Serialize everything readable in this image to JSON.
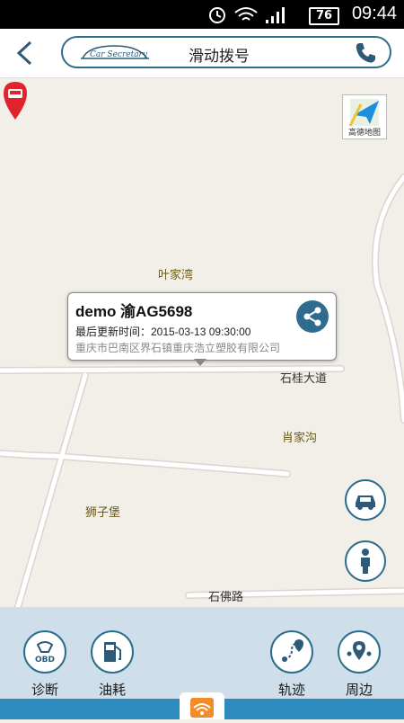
{
  "status_bar": {
    "battery": "76",
    "time": "09:44"
  },
  "header": {
    "logo_text": "Car Secretary",
    "title": "滑动拨号"
  },
  "map": {
    "provider_label": "高德地图",
    "places": [
      "叶家湾",
      "肖家沟",
      "狮子堡"
    ],
    "roads": [
      "石桂大道",
      "石佛路"
    ]
  },
  "vehicle_popup": {
    "title": "demo  渝AG5698",
    "updated": "最后更新时间：2015-03-13 09:30:00",
    "address": "重庆市巴南区界石镇重庆浩立塑胶有限公司"
  },
  "toolbar": {
    "items": [
      {
        "label": "诊断",
        "icon": "obd-icon",
        "icon_text": "OBD"
      },
      {
        "label": "油耗",
        "icon": "fuel-icon"
      },
      {
        "label": "轨迹",
        "icon": "track-icon"
      },
      {
        "label": "周边",
        "icon": "nearby-icon"
      }
    ]
  },
  "colors": {
    "accent": "#2d6d8c",
    "marker": "#e0242c",
    "bottom_strip": "#2d8bbf"
  }
}
